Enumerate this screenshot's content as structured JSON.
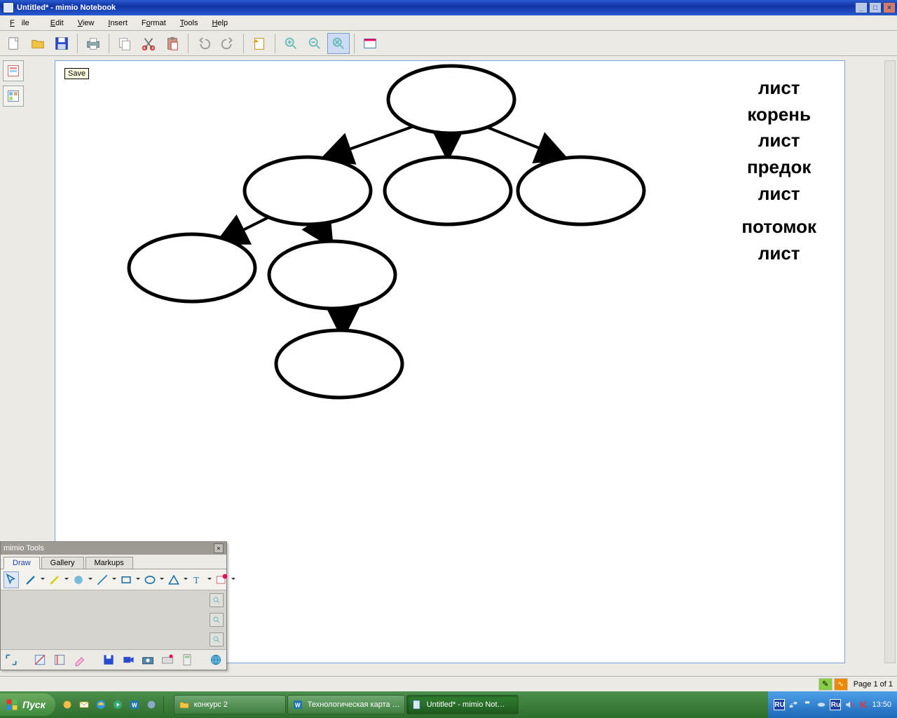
{
  "title": "Untitled* - mimio Notebook",
  "menu": {
    "file": "File",
    "edit": "Edit",
    "view": "View",
    "insert": "Insert",
    "format": "Format",
    "tools": "Tools",
    "help": "Help"
  },
  "tooltip": "Save",
  "wordbank": [
    "лист",
    "корень",
    "лист",
    "предок",
    "лист",
    "потомок",
    "лист"
  ],
  "palette": {
    "title": "mimio Tools",
    "tabs": {
      "draw": "Draw",
      "gallery": "Gallery",
      "markups": "Markups"
    }
  },
  "status": {
    "page": "Page 1 of 1"
  },
  "taskbar": {
    "start": "Пуск",
    "tasks": [
      {
        "label": "конкурс 2",
        "icon": "folder"
      },
      {
        "label": "Технологическая карта …",
        "icon": "word"
      },
      {
        "label": "Untitled* - mimio Not…",
        "icon": "mimio",
        "active": true
      }
    ],
    "lang1": "RU",
    "lang2": "Ru",
    "clock": "13:50"
  }
}
